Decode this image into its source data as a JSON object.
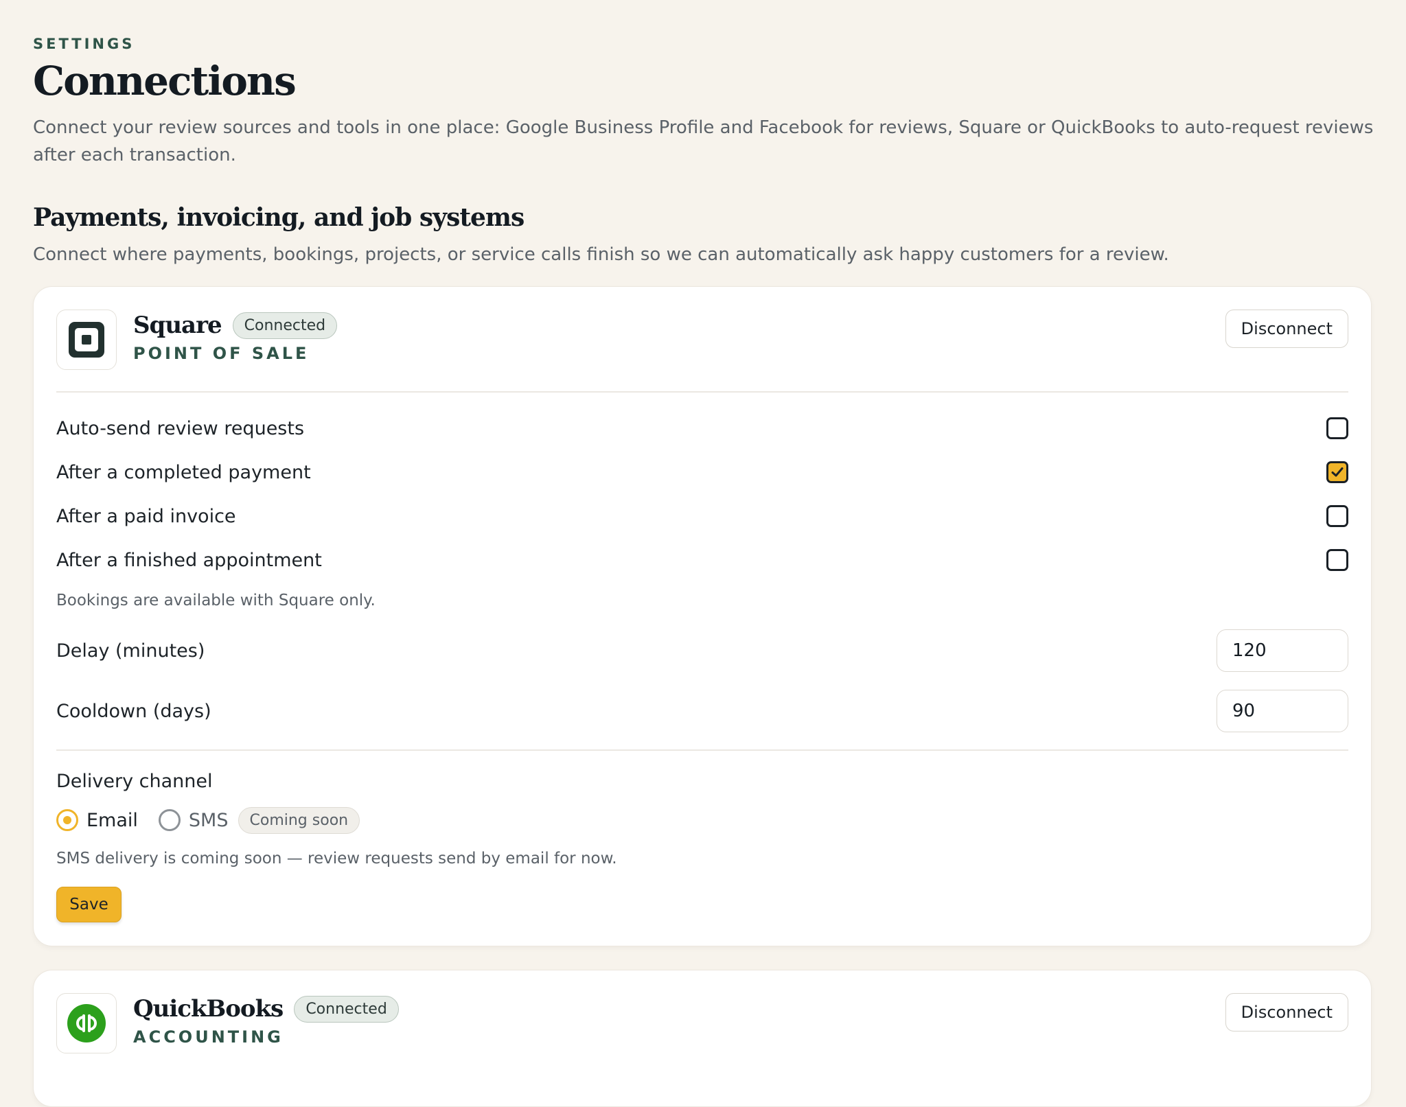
{
  "header": {
    "eyebrow": "SETTINGS",
    "title": "Connections",
    "description": "Connect your review sources and tools in one place: Google Business Profile and Facebook for reviews, Square or QuickBooks to auto-request reviews after each transaction."
  },
  "section": {
    "title": "Payments, invoicing, and job systems",
    "description": "Connect where payments, bookings, projects, or service calls finish so we can automatically ask happy customers for a review."
  },
  "square": {
    "name": "Square",
    "status": "Connected",
    "category": "POINT OF SALE",
    "logo_icon": "square-logo-icon",
    "disconnect_label": "Disconnect",
    "options": [
      {
        "label": "Auto-send review requests",
        "checked": false
      },
      {
        "label": "After a completed payment",
        "checked": true
      },
      {
        "label": "After a paid invoice",
        "checked": false
      },
      {
        "label": "After a finished appointment",
        "checked": false
      }
    ],
    "bookings_hint": "Bookings are available with Square only.",
    "delay_label": "Delay (minutes)",
    "delay_value": "120",
    "cooldown_label": "Cooldown (days)",
    "cooldown_value": "90",
    "channel_title": "Delivery channel",
    "channel_email": "Email",
    "channel_sms": "SMS",
    "coming_soon": "Coming soon",
    "selected_channel": "Email",
    "sms_hint": "SMS delivery is coming soon — review requests send by email for now.",
    "save_label": "Save"
  },
  "quickbooks": {
    "name": "QuickBooks",
    "status": "Connected",
    "category": "ACCOUNTING",
    "logo_icon": "quickbooks-logo-icon",
    "disconnect_label": "Disconnect"
  },
  "colors": {
    "accent": "#f0b429",
    "brand_green": "#2f5448",
    "quickbooks_green": "#2ca01c",
    "background": "#f7f3ec"
  }
}
